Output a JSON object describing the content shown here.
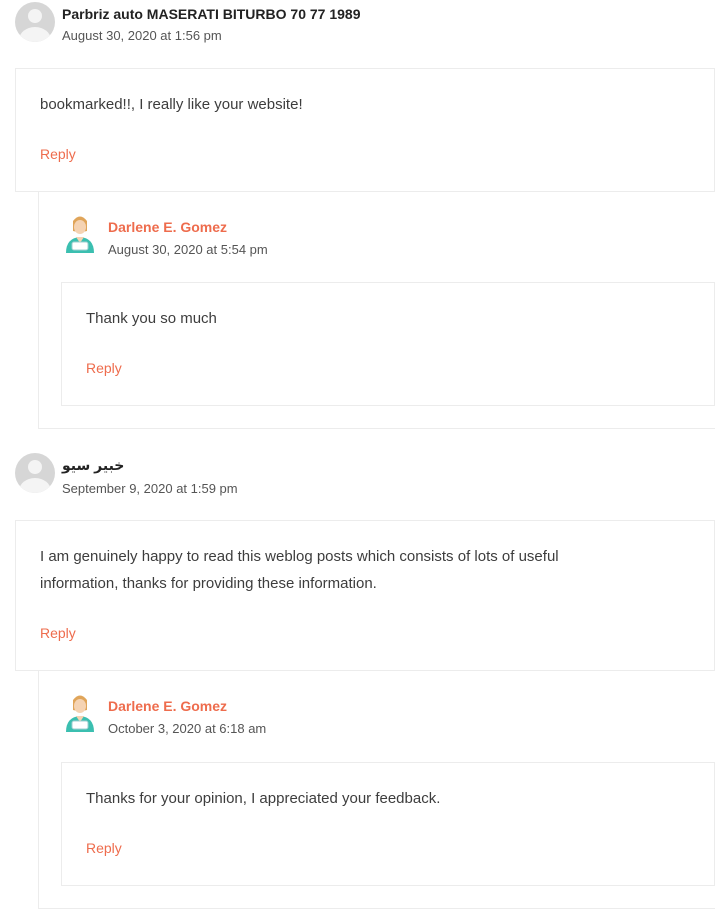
{
  "comments": [
    {
      "author": "Parbriz auto MASERATI BITURBO 70 77 1989",
      "date": "August 30, 2020 at 1:56 pm",
      "text": "bookmarked!!, I really like your website!",
      "reply_label": "Reply",
      "reply": {
        "author": "Darlene E. Gomez",
        "date": "August 30, 2020 at 5:54 pm",
        "text": "Thank you so much",
        "reply_label": "Reply"
      }
    },
    {
      "author": "خبیر سیو",
      "date": "September 9, 2020 at 1:59 pm",
      "text_line1": "I am genuinely happy to read this weblog posts which consists of lots of useful",
      "text_line2": "information, thanks for providing these information.",
      "reply_label": "Reply",
      "reply": {
        "author": "Darlene E. Gomez",
        "date": "October 3, 2020 at 6:18 am",
        "text": "Thanks for your opinion, I appreciated your feedback.",
        "reply_label": "Reply"
      }
    }
  ],
  "colors": {
    "accent": "#ee6c4d",
    "border": "#ececec",
    "avatar_gray": "#d6d6d6"
  },
  "icons": {
    "default_avatar": "default-avatar-icon",
    "admin_avatar": "nurse-avatar-icon"
  }
}
